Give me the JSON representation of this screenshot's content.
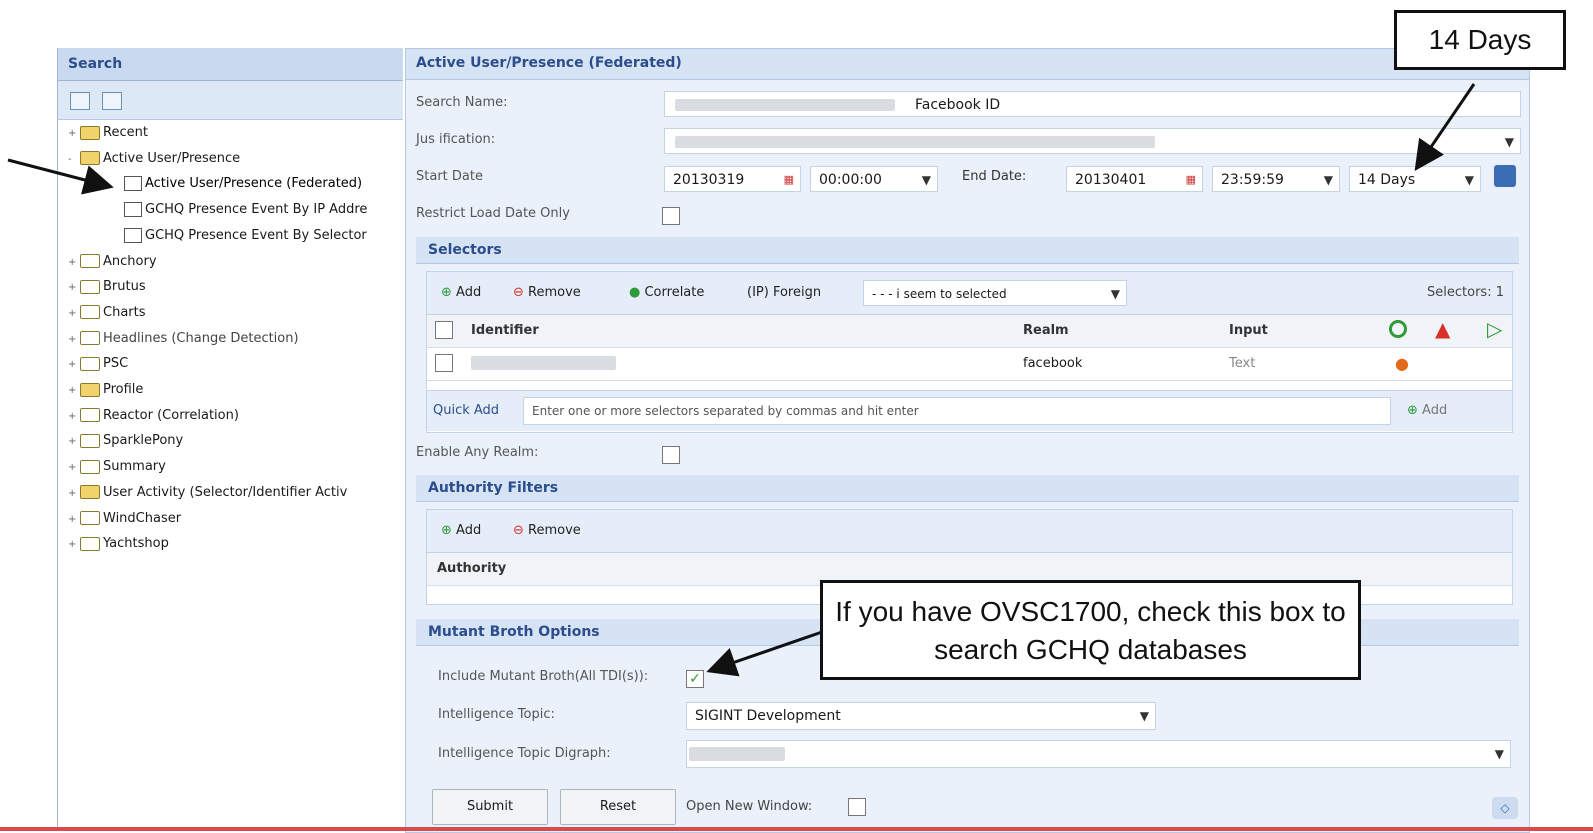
{
  "left_panel": {
    "title": "Search",
    "tree": [
      {
        "label": "Recent",
        "expander": "+",
        "icon": "folder"
      },
      {
        "label": "Active User/Presence",
        "expander": "-",
        "icon": "folder"
      },
      {
        "label": "Active User/Presence (Federated)",
        "expander": "",
        "icon": "search-doc"
      },
      {
        "label": "GCHQ Presence Event By IP Addre",
        "expander": "",
        "icon": "search-doc"
      },
      {
        "label": "GCHQ Presence Event By Selector",
        "expander": "",
        "icon": "search-doc"
      },
      {
        "label": "Anchory",
        "expander": "+",
        "icon": "folder"
      },
      {
        "label": "Brutus",
        "expander": "+",
        "icon": "folder"
      },
      {
        "label": "Charts",
        "expander": "+",
        "icon": "folder"
      },
      {
        "label": "Headlines (Change Detection)",
        "expander": "+",
        "icon": "folder"
      },
      {
        "label": "PSC",
        "expander": "+",
        "icon": "folder"
      },
      {
        "label": "Profile",
        "expander": "+",
        "icon": "folder"
      },
      {
        "label": "Reactor (Correlation)",
        "expander": "+",
        "icon": "folder"
      },
      {
        "label": "SparklePony",
        "expander": "+",
        "icon": "folder"
      },
      {
        "label": "Summary",
        "expander": "+",
        "icon": "folder"
      },
      {
        "label": "User Activity (Selector/Identifier Activ",
        "expander": "+",
        "icon": "folder"
      },
      {
        "label": "WindChaser",
        "expander": "+",
        "icon": "folder"
      },
      {
        "label": "Yachtshop",
        "expander": "+",
        "icon": "folder"
      }
    ]
  },
  "main": {
    "title": "Active User/Presence (Federated)",
    "search_name_label": "Search Name:",
    "search_name_value": "Facebook ID",
    "justification_label": "Jus ification:",
    "start_date_label": "Start Date",
    "start_date": "20130319",
    "start_time": "00:00:00",
    "end_date_label": "End Date:",
    "end_date": "20130401",
    "end_time": "23:59:59",
    "range": "14 Days",
    "restrict_label": "Restrict Load Date Only",
    "selectors": {
      "title": "Selectors",
      "add": "Add",
      "remove": "Remove",
      "correlate": "Correlate",
      "ip_foreign": "(IP) Foreign",
      "apply_to": "- - - i seem to selected",
      "count": "Selectors: 1",
      "col_identifier": "Identifier",
      "col_realm": "Realm",
      "col_input": "Input",
      "row_realm": "facebook",
      "row_input": "Text",
      "quick_add_label": "Quick Add",
      "quick_add_placeholder": "Enter one or more selectors separated by commas and hit enter",
      "quick_add_button": "Add"
    },
    "enable_any_realm_label": "Enable Any Realm:",
    "authority": {
      "title": "Authority Filters",
      "add": "Add",
      "remove": "Remove",
      "col_authority": "Authority"
    },
    "mutant": {
      "title": "Mutant Broth Options",
      "include_label": "Include Mutant Broth(All TDI(s)):",
      "include_checked": true,
      "topic_label": "Intelligence Topic:",
      "topic_value": "SIGINT Development",
      "digraph_label": "Intelligence Topic Digraph:"
    },
    "submit": "Submit",
    "reset": "Reset",
    "open_new_window": "Open New Window:"
  },
  "callouts": {
    "days": "14 Days",
    "ovsc": "If you have OVSC1700, check this box to search GCHQ databases"
  },
  "colors": {
    "header_blue": "#2c4d8c",
    "panel_bg": "#eaf1fa",
    "accent_green": "#2e9a3a",
    "accent_red": "#d9302a"
  }
}
